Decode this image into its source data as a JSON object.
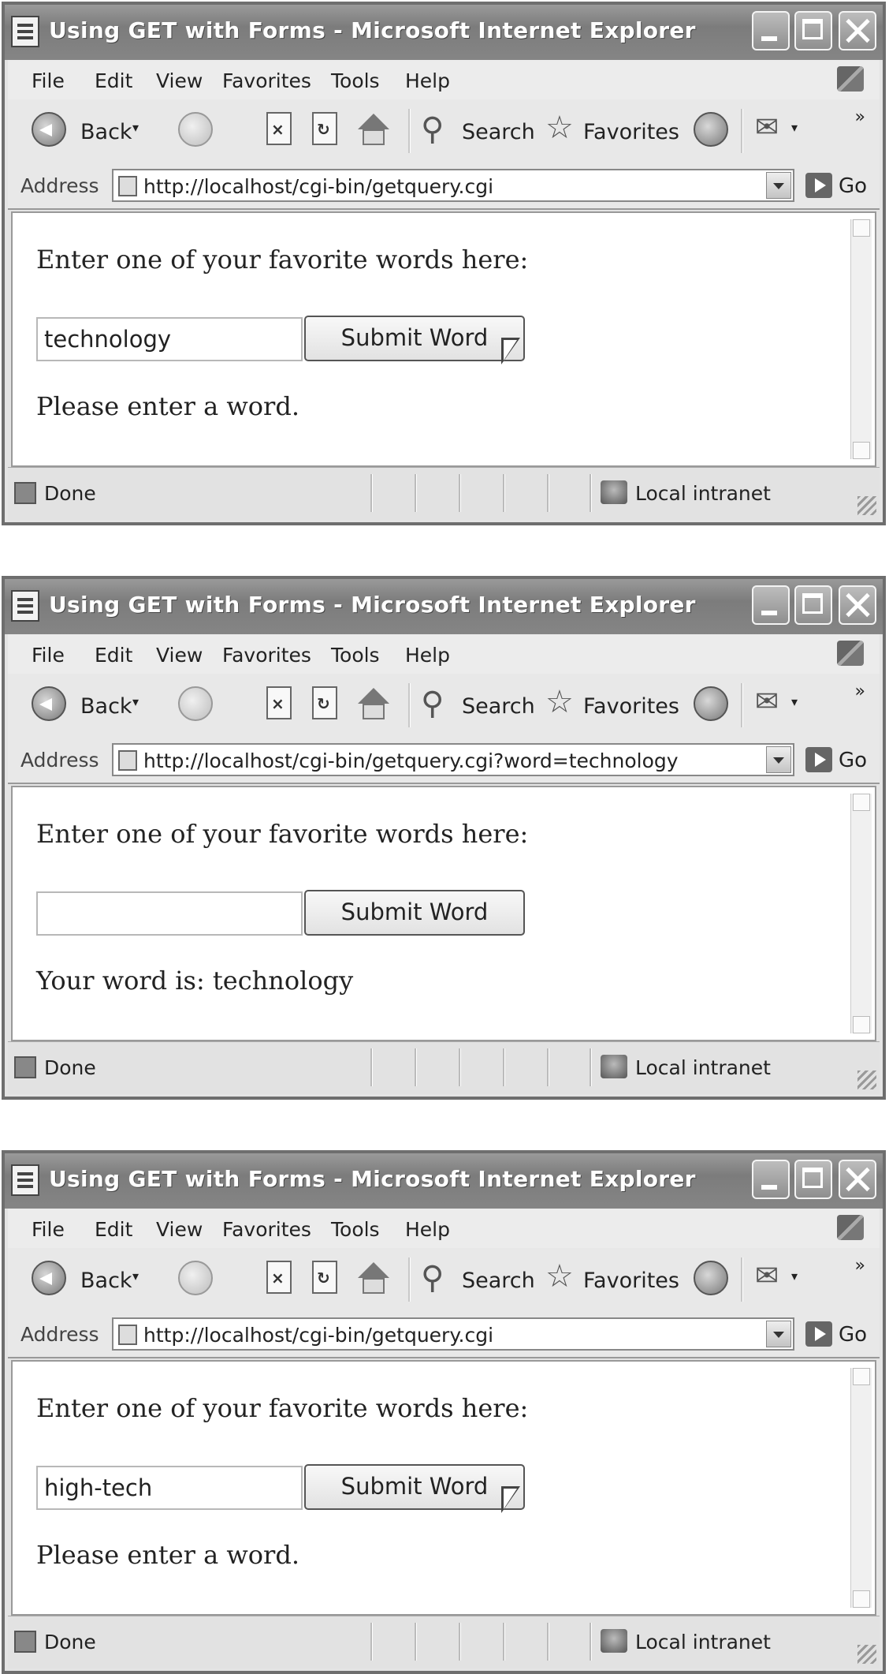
{
  "windows": [
    {
      "title": "Using GET with Forms - Microsoft Internet Explorer",
      "menu": [
        "File",
        "Edit",
        "View",
        "Favorites",
        "Tools",
        "Help"
      ],
      "toolbar": {
        "back": "Back",
        "search": "Search",
        "favorites": "Favorites"
      },
      "address": {
        "label": "Address",
        "url": "http://localhost/cgi-bin/getquery.cgi",
        "go": "Go"
      },
      "content": {
        "prompt": "Enter one of your favorite words here:",
        "input_value": "technology",
        "button": "Submit Word",
        "message": "Please enter a word."
      },
      "status": {
        "left": "Done",
        "zone": "Local intranet"
      }
    },
    {
      "title": "Using GET with Forms - Microsoft Internet Explorer",
      "menu": [
        "File",
        "Edit",
        "View",
        "Favorites",
        "Tools",
        "Help"
      ],
      "toolbar": {
        "back": "Back",
        "search": "Search",
        "favorites": "Favorites"
      },
      "address": {
        "label": "Address",
        "url": "http://localhost/cgi-bin/getquery.cgi?word=technology",
        "go": "Go"
      },
      "content": {
        "prompt": "Enter one of your favorite words here:",
        "input_value": "",
        "button": "Submit Word",
        "message": "Your word is: technology"
      },
      "status": {
        "left": "Done",
        "zone": "Local intranet"
      }
    },
    {
      "title": "Using GET with Forms - Microsoft Internet Explorer",
      "menu": [
        "File",
        "Edit",
        "View",
        "Favorites",
        "Tools",
        "Help"
      ],
      "toolbar": {
        "back": "Back",
        "search": "Search",
        "favorites": "Favorites"
      },
      "address": {
        "label": "Address",
        "url": "http://localhost/cgi-bin/getquery.cgi",
        "go": "Go"
      },
      "content": {
        "prompt": "Enter one of your favorite words here:",
        "input_value": "high-tech",
        "button": "Submit Word",
        "message": "Please enter a word."
      },
      "status": {
        "left": "Done",
        "zone": "Local intranet"
      }
    }
  ]
}
